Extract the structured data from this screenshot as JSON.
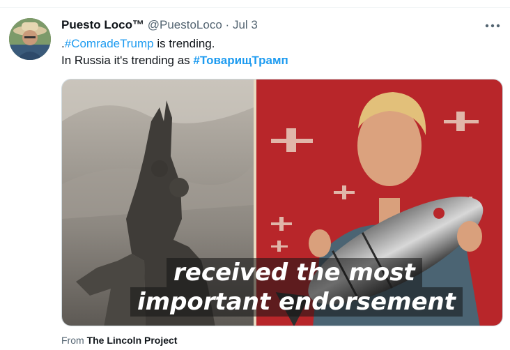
{
  "tweet": {
    "author_name": "Puesto Loco™",
    "handle": "@PuestoLoco",
    "separator": "·",
    "date": "Jul 3",
    "line1_prefix": ".",
    "line1_hashtag": "#ComradeTrump",
    "line1_suffix": " is trending.",
    "line2_prefix": "In Russia it's trending as ",
    "line2_hashtag": "#ТоварищТрамп"
  },
  "media": {
    "caption_line1": "received the most",
    "caption_line2": "important endorsement"
  },
  "attribution": {
    "prefix": "From ",
    "source": "The Lincoln Project"
  },
  "colors": {
    "link": "#1d9bf0",
    "poster_red": "#b8262a"
  },
  "icons": {
    "more": "more-horizontal-icon"
  }
}
